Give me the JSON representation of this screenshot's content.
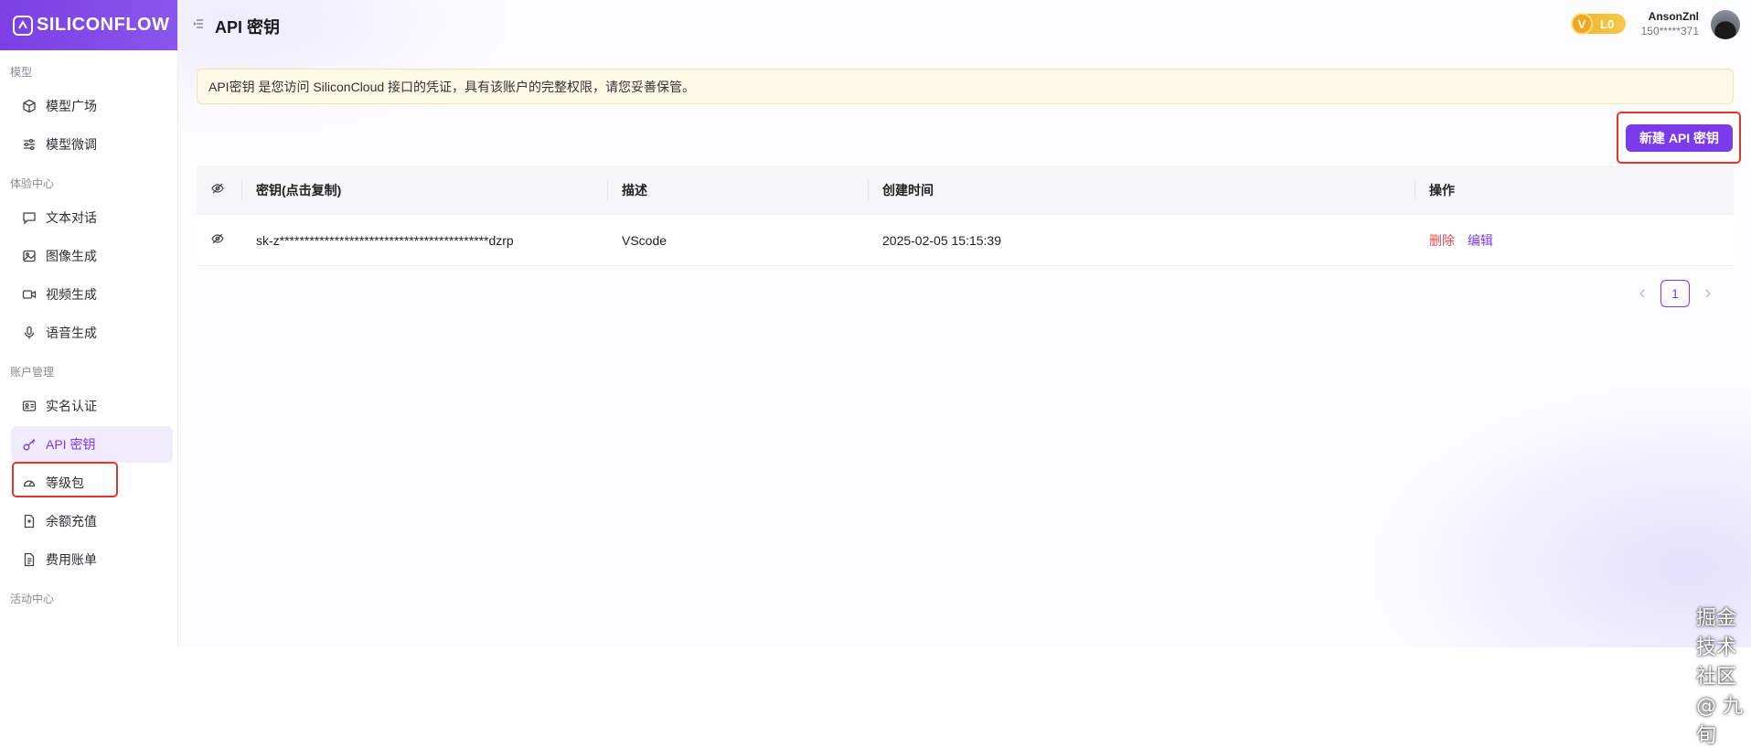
{
  "brand": {
    "name": "SILICONFLOW"
  },
  "sidebar": {
    "sections": [
      {
        "title": "模型",
        "items": [
          {
            "label": "模型广场",
            "icon": "cube-icon"
          },
          {
            "label": "模型微调",
            "icon": "sliders-icon"
          }
        ]
      },
      {
        "title": "体验中心",
        "items": [
          {
            "label": "文本对话",
            "icon": "chat-icon"
          },
          {
            "label": "图像生成",
            "icon": "image-icon"
          },
          {
            "label": "视频生成",
            "icon": "video-icon"
          },
          {
            "label": "语音生成",
            "icon": "mic-icon"
          }
        ]
      },
      {
        "title": "账户管理",
        "items": [
          {
            "label": "实名认证",
            "icon": "id-card-icon"
          },
          {
            "label": "API 密钥",
            "icon": "key-icon",
            "active": true
          },
          {
            "label": "等级包",
            "icon": "gauge-icon"
          },
          {
            "label": "余额充值",
            "icon": "wallet-icon"
          },
          {
            "label": "费用账单",
            "icon": "receipt-icon"
          }
        ]
      },
      {
        "title": "活动中心",
        "items": []
      }
    ]
  },
  "header": {
    "title": "API 密钥",
    "level": {
      "badge": "V",
      "label": "L0"
    },
    "user": {
      "name": "AnsonZnl",
      "phone": "150*****371"
    }
  },
  "notice": "API密钥 是您访问 SiliconCloud 接口的凭证，具有该账户的完整权限，请您妥善保管。",
  "actions": {
    "new_key": "新建 API 密钥"
  },
  "table": {
    "columns": [
      "密钥(点击复制)",
      "描述",
      "创建时间",
      "操作"
    ],
    "rows": [
      {
        "key": "sk-z******************************************dzrp",
        "description": "VScode",
        "created": "2025-02-05 15:15:39",
        "delete": "删除",
        "edit": "编辑"
      }
    ]
  },
  "pagination": {
    "current": "1"
  },
  "watermark": "掘金技术社区 @ 九旬",
  "colors": {
    "accent": "#7c3aed",
    "danger": "#e5484d",
    "highlight": "#e5332a",
    "notice_bg": "#fdf9e6"
  }
}
